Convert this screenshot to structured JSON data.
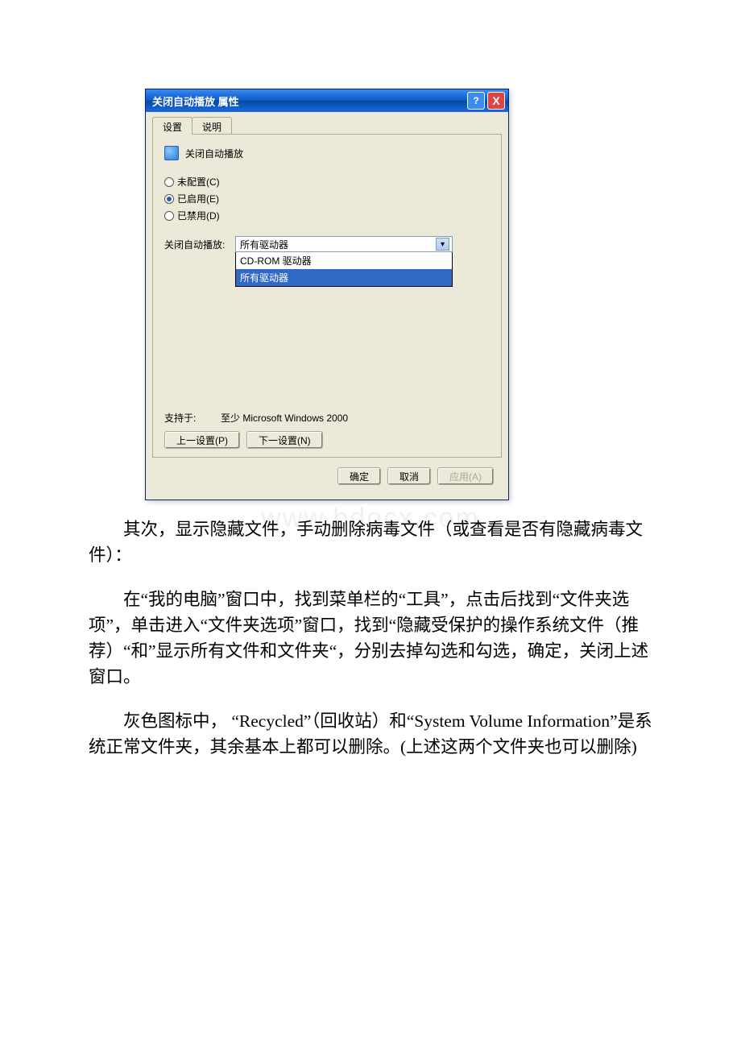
{
  "dialog": {
    "title": "关闭自动播放 属性",
    "help_btn": "?",
    "close_btn": "X",
    "tabs": {
      "settings": "设置",
      "explain": "说明"
    },
    "policy_name": "关闭自动播放",
    "radios": {
      "not_configured": "未配置(C)",
      "not_configured_key": "C",
      "enabled": "已启用(E)",
      "enabled_key": "E",
      "disabled": "已禁用(D)",
      "disabled_key": "D"
    },
    "dropdown": {
      "label": "关闭自动播放:",
      "selected": "所有驱动器",
      "options": [
        "CD-ROM 驱动器",
        "所有驱动器"
      ]
    },
    "support": {
      "label": "支持于:",
      "value": "至少 Microsoft Windows 2000"
    },
    "nav": {
      "prev": "上一设置(P)",
      "next": "下一设置(N)"
    },
    "footer": {
      "ok": "确定",
      "cancel": "取消",
      "apply": "应用(A)"
    }
  },
  "watermark": "www.bdocx.com",
  "paragraphs": {
    "p1": "其次，显示隐藏文件，手动删除病毒文件（或查看是否有隐藏病毒文件）：",
    "p2": "在“我的电脑”窗口中，找到菜单栏的“工具”，点击后找到“文件夹选项”，单击进入“文件夹选项”窗口，找到“隐藏受保护的操作系统文件（推荐）“和”显示所有文件和文件夹“，分别去掉勾选和勾选，确定，关闭上述窗口。",
    "p3": "灰色图标中， “Recycled”（回收站）和“System Volume Information”是系统正常文件夹，其余基本上都可以删除。(上述这两个文件夹也可以删除)"
  }
}
